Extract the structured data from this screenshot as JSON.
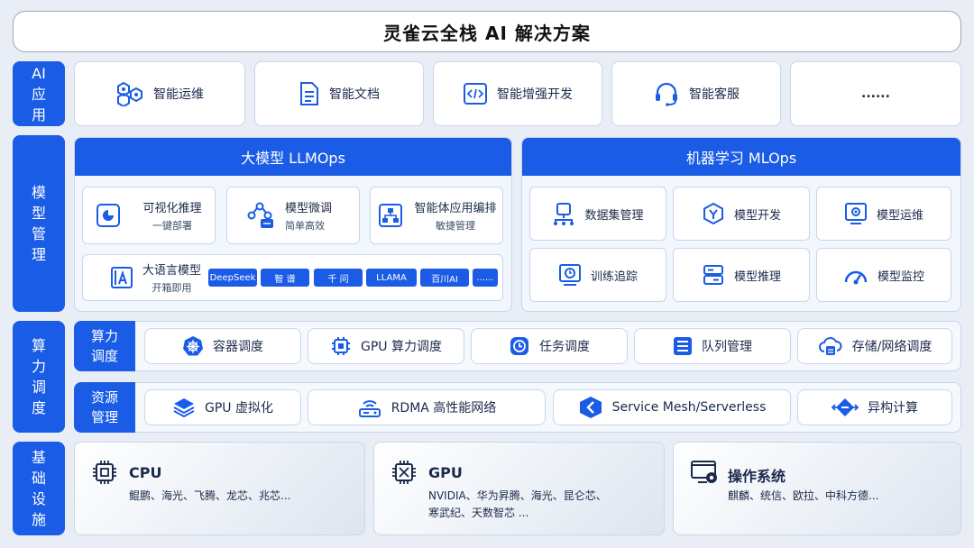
{
  "title": "灵雀云全栈 AI 解决方案",
  "colors": {
    "accent": "#1a5ce6",
    "background": "#e9eef6",
    "card": "#ffffff"
  },
  "layers": {
    "ai_app": {
      "label": [
        "AI",
        "应",
        "用"
      ],
      "items": [
        {
          "label": "智能运维",
          "icon": "hexagon-cluster-icon"
        },
        {
          "label": "智能文档",
          "icon": "document-icon"
        },
        {
          "label": "智能增强开发",
          "icon": "code-icon"
        },
        {
          "label": "智能客服",
          "icon": "headset-icon"
        },
        {
          "label": "......",
          "icon": ""
        }
      ]
    },
    "model_mgmt": {
      "label": [
        "模",
        "型",
        "管",
        "理"
      ],
      "llmops": {
        "title": "大模型 LLMOps",
        "cards": [
          {
            "title": "可视化推理",
            "subtitle": "一键部署",
            "icon": "chart-pie-icon"
          },
          {
            "title": "模型微调",
            "subtitle": "简单高效",
            "icon": "network-tune-icon"
          },
          {
            "title": "智能体应用编排",
            "subtitle": "敏捷管理",
            "icon": "flow-chart-icon"
          }
        ],
        "llm": {
          "title": "大语言模型",
          "subtitle": "开箱即用",
          "icon": "text-box-icon"
        },
        "tags": [
          "DeepSeek",
          "智 谱",
          "千 问",
          "LLAMA",
          "百川AI",
          "......"
        ]
      },
      "mlops": {
        "title": "机器学习 MLOps",
        "cards": [
          {
            "label": "数据集管理",
            "icon": "dataset-icon"
          },
          {
            "label": "模型开发",
            "icon": "model-dev-icon"
          },
          {
            "label": "模型运维",
            "icon": "model-ops-icon"
          },
          {
            "label": "训练追踪",
            "icon": "training-track-icon"
          },
          {
            "label": "模型推理",
            "icon": "inference-icon"
          },
          {
            "label": "模型监控",
            "icon": "gauge-icon"
          }
        ]
      }
    },
    "compute": {
      "label": [
        "算",
        "力",
        "调",
        "度"
      ],
      "scheduling": {
        "label": [
          "算力",
          "调度"
        ],
        "items": [
          {
            "label": "容器调度",
            "icon": "helm-icon"
          },
          {
            "label": "GPU 算力调度",
            "icon": "chip-icon"
          },
          {
            "label": "任务调度",
            "icon": "clock-icon"
          },
          {
            "label": "队列管理",
            "icon": "list-icon"
          },
          {
            "label": "存储/网络调度",
            "icon": "cloud-storage-icon"
          }
        ]
      },
      "resources": {
        "label": [
          "资源",
          "管理"
        ],
        "items": [
          {
            "label": "GPU 虚拟化",
            "icon": "layers-icon"
          },
          {
            "label": "RDMA 高性能网络",
            "icon": "router-icon"
          },
          {
            "label": "Service Mesh/Serverless",
            "icon": "mesh-icon"
          },
          {
            "label": "异构计算",
            "icon": "diamond-arrows-icon"
          }
        ]
      }
    },
    "infra": {
      "label": [
        "基",
        "础",
        "设",
        "施"
      ],
      "items": [
        {
          "title": "CPU",
          "desc": [
            "鲲鹏、海光、飞腾、龙芯、兆芯..."
          ],
          "icon": "cpu-icon"
        },
        {
          "title": "GPU",
          "desc": [
            "NVIDIA、华为昇腾、海光、昆仑芯、",
            "寒武纪、天数智芯 ..."
          ],
          "icon": "gpu-icon"
        },
        {
          "title": "操作系统",
          "desc": [
            "麒麟、统信、欧拉、中科方德..."
          ],
          "icon": "os-monitor-icon"
        }
      ]
    }
  }
}
